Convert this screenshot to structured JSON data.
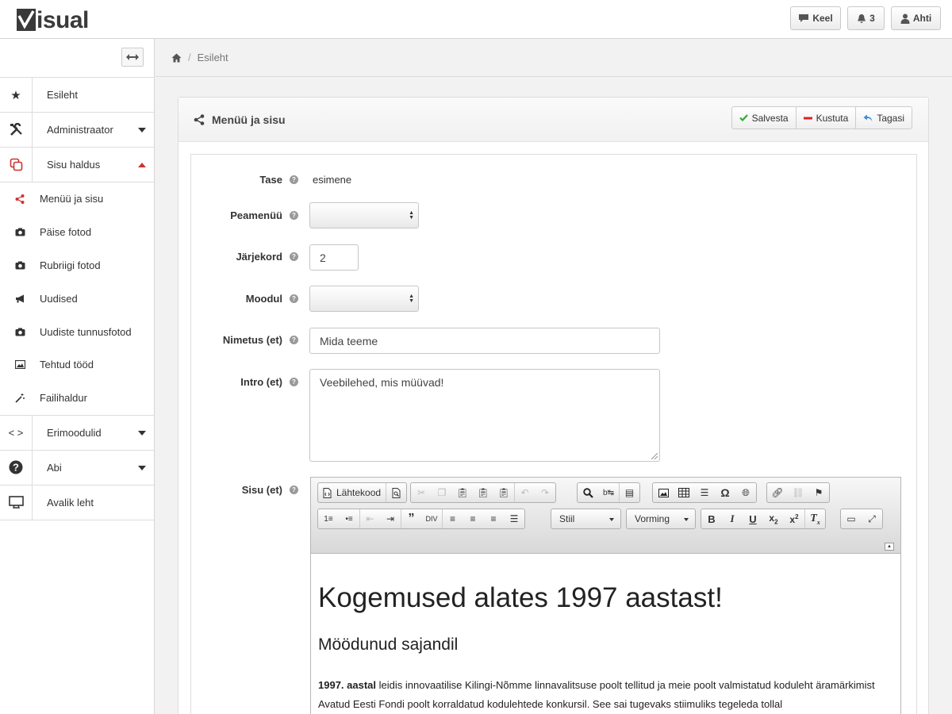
{
  "app": {
    "logo_text": "isual"
  },
  "topbar": {
    "language_label": "Keel",
    "notifications_count": "3",
    "user_name": "Ahti"
  },
  "breadcrumb": {
    "current": "Esileht"
  },
  "sidebar": {
    "items": [
      {
        "label": "Esileht",
        "icon": "star-icon"
      },
      {
        "label": "Administraator",
        "icon": "tools-icon"
      },
      {
        "label": "Sisu haldus",
        "icon": "copy-icon"
      }
    ],
    "subitems": [
      {
        "label": "Menüü ja sisu",
        "icon": "share-icon"
      },
      {
        "label": "Päise fotod",
        "icon": "camera-icon"
      },
      {
        "label": "Rubriigi fotod",
        "icon": "camera-icon"
      },
      {
        "label": "Uudised",
        "icon": "bullhorn-icon"
      },
      {
        "label": "Uudiste tunnusfotod",
        "icon": "camera-icon"
      },
      {
        "label": "Tehtud tööd",
        "icon": "picture-icon"
      },
      {
        "label": "Failihaldur",
        "icon": "magic-wand-icon"
      }
    ],
    "bottom_items": [
      {
        "label": "Erimoodulid",
        "icon": "code-icon"
      },
      {
        "label": "Abi",
        "icon": "question-icon"
      },
      {
        "label": "Avalik leht",
        "icon": "monitor-icon"
      }
    ]
  },
  "panel": {
    "title": "Menüü ja sisu",
    "buttons": {
      "save": "Salvesta",
      "delete": "Kustuta",
      "back": "Tagasi"
    }
  },
  "form": {
    "level_label": "Tase",
    "level_value": "esimene",
    "mainmenu_label": "Peamenüü",
    "order_label": "Järjekord",
    "order_value": "2",
    "module_label": "Moodul",
    "name_label": "Nimetus (et)",
    "name_value": "Mida teeme",
    "intro_label": "Intro (et)",
    "intro_value": "Veebilehed, mis müüvad!",
    "content_label": "Sisu (et)"
  },
  "editor": {
    "source_label": "Lähtekood",
    "style_combo": "Stiil",
    "format_combo": "Vorming",
    "heading1": "Kogemused alates 1997 aastast!",
    "heading2": "Möödunud sajandil",
    "para_bold": "1997. aastal",
    "para_rest": " leidis innovaatilise Kilingi-Nõmme linnavalitsuse poolt tellitud ja meie poolt valmistatud koduleht äramärkimist Avatud Eesti Fondi poolt korraldatud kodulehtede konkursil. See sai tugevaks stiimuliks tegeleda tollal"
  }
}
